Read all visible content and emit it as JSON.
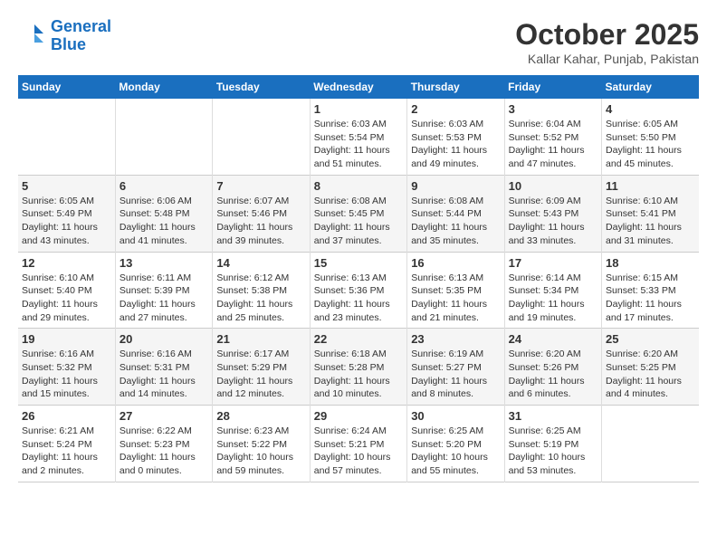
{
  "header": {
    "logo_line1": "General",
    "logo_line2": "Blue",
    "title": "October 2025",
    "subtitle": "Kallar Kahar, Punjab, Pakistan"
  },
  "calendar": {
    "days_of_week": [
      "Sunday",
      "Monday",
      "Tuesday",
      "Wednesday",
      "Thursday",
      "Friday",
      "Saturday"
    ],
    "weeks": [
      [
        {
          "day": "",
          "info": ""
        },
        {
          "day": "",
          "info": ""
        },
        {
          "day": "",
          "info": ""
        },
        {
          "day": "1",
          "info": "Sunrise: 6:03 AM\nSunset: 5:54 PM\nDaylight: 11 hours\nand 51 minutes."
        },
        {
          "day": "2",
          "info": "Sunrise: 6:03 AM\nSunset: 5:53 PM\nDaylight: 11 hours\nand 49 minutes."
        },
        {
          "day": "3",
          "info": "Sunrise: 6:04 AM\nSunset: 5:52 PM\nDaylight: 11 hours\nand 47 minutes."
        },
        {
          "day": "4",
          "info": "Sunrise: 6:05 AM\nSunset: 5:50 PM\nDaylight: 11 hours\nand 45 minutes."
        }
      ],
      [
        {
          "day": "5",
          "info": "Sunrise: 6:05 AM\nSunset: 5:49 PM\nDaylight: 11 hours\nand 43 minutes."
        },
        {
          "day": "6",
          "info": "Sunrise: 6:06 AM\nSunset: 5:48 PM\nDaylight: 11 hours\nand 41 minutes."
        },
        {
          "day": "7",
          "info": "Sunrise: 6:07 AM\nSunset: 5:46 PM\nDaylight: 11 hours\nand 39 minutes."
        },
        {
          "day": "8",
          "info": "Sunrise: 6:08 AM\nSunset: 5:45 PM\nDaylight: 11 hours\nand 37 minutes."
        },
        {
          "day": "9",
          "info": "Sunrise: 6:08 AM\nSunset: 5:44 PM\nDaylight: 11 hours\nand 35 minutes."
        },
        {
          "day": "10",
          "info": "Sunrise: 6:09 AM\nSunset: 5:43 PM\nDaylight: 11 hours\nand 33 minutes."
        },
        {
          "day": "11",
          "info": "Sunrise: 6:10 AM\nSunset: 5:41 PM\nDaylight: 11 hours\nand 31 minutes."
        }
      ],
      [
        {
          "day": "12",
          "info": "Sunrise: 6:10 AM\nSunset: 5:40 PM\nDaylight: 11 hours\nand 29 minutes."
        },
        {
          "day": "13",
          "info": "Sunrise: 6:11 AM\nSunset: 5:39 PM\nDaylight: 11 hours\nand 27 minutes."
        },
        {
          "day": "14",
          "info": "Sunrise: 6:12 AM\nSunset: 5:38 PM\nDaylight: 11 hours\nand 25 minutes."
        },
        {
          "day": "15",
          "info": "Sunrise: 6:13 AM\nSunset: 5:36 PM\nDaylight: 11 hours\nand 23 minutes."
        },
        {
          "day": "16",
          "info": "Sunrise: 6:13 AM\nSunset: 5:35 PM\nDaylight: 11 hours\nand 21 minutes."
        },
        {
          "day": "17",
          "info": "Sunrise: 6:14 AM\nSunset: 5:34 PM\nDaylight: 11 hours\nand 19 minutes."
        },
        {
          "day": "18",
          "info": "Sunrise: 6:15 AM\nSunset: 5:33 PM\nDaylight: 11 hours\nand 17 minutes."
        }
      ],
      [
        {
          "day": "19",
          "info": "Sunrise: 6:16 AM\nSunset: 5:32 PM\nDaylight: 11 hours\nand 15 minutes."
        },
        {
          "day": "20",
          "info": "Sunrise: 6:16 AM\nSunset: 5:31 PM\nDaylight: 11 hours\nand 14 minutes."
        },
        {
          "day": "21",
          "info": "Sunrise: 6:17 AM\nSunset: 5:29 PM\nDaylight: 11 hours\nand 12 minutes."
        },
        {
          "day": "22",
          "info": "Sunrise: 6:18 AM\nSunset: 5:28 PM\nDaylight: 11 hours\nand 10 minutes."
        },
        {
          "day": "23",
          "info": "Sunrise: 6:19 AM\nSunset: 5:27 PM\nDaylight: 11 hours\nand 8 minutes."
        },
        {
          "day": "24",
          "info": "Sunrise: 6:20 AM\nSunset: 5:26 PM\nDaylight: 11 hours\nand 6 minutes."
        },
        {
          "day": "25",
          "info": "Sunrise: 6:20 AM\nSunset: 5:25 PM\nDaylight: 11 hours\nand 4 minutes."
        }
      ],
      [
        {
          "day": "26",
          "info": "Sunrise: 6:21 AM\nSunset: 5:24 PM\nDaylight: 11 hours\nand 2 minutes."
        },
        {
          "day": "27",
          "info": "Sunrise: 6:22 AM\nSunset: 5:23 PM\nDaylight: 11 hours\nand 0 minutes."
        },
        {
          "day": "28",
          "info": "Sunrise: 6:23 AM\nSunset: 5:22 PM\nDaylight: 10 hours\nand 59 minutes."
        },
        {
          "day": "29",
          "info": "Sunrise: 6:24 AM\nSunset: 5:21 PM\nDaylight: 10 hours\nand 57 minutes."
        },
        {
          "day": "30",
          "info": "Sunrise: 6:25 AM\nSunset: 5:20 PM\nDaylight: 10 hours\nand 55 minutes."
        },
        {
          "day": "31",
          "info": "Sunrise: 6:25 AM\nSunset: 5:19 PM\nDaylight: 10 hours\nand 53 minutes."
        },
        {
          "day": "",
          "info": ""
        }
      ]
    ]
  }
}
